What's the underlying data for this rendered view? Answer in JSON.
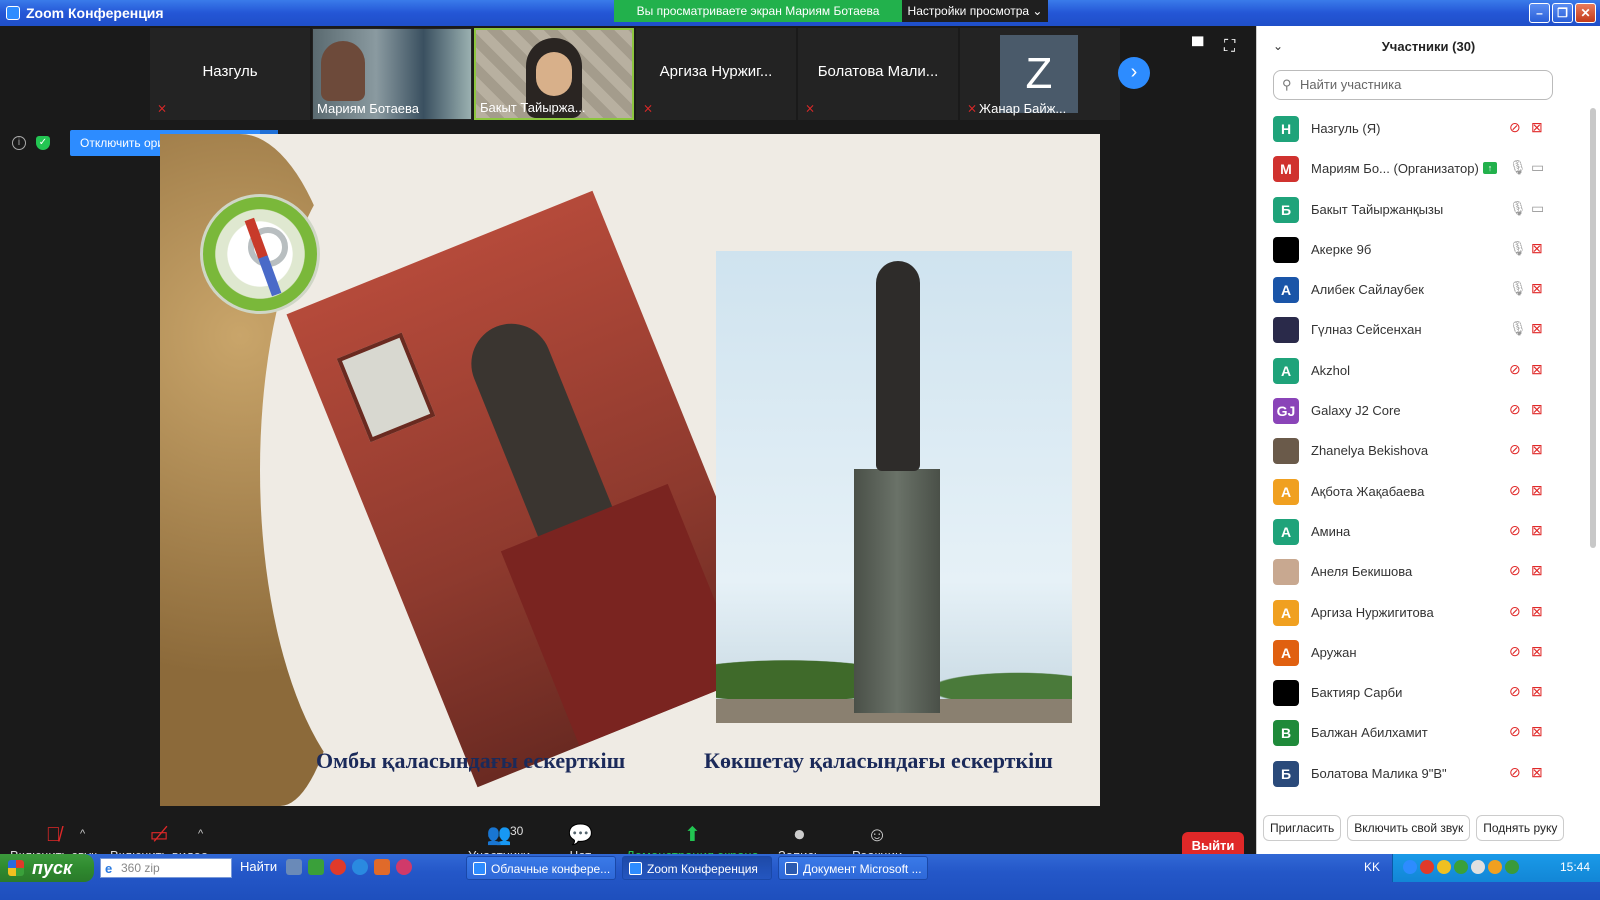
{
  "window": {
    "title": "Zoom Конференция",
    "share_banner": "Вы просматриваете экран Мариям Ботаева",
    "view_options": "Настройки просмотра"
  },
  "video_strip": [
    {
      "name": "Назгуль",
      "type": "name",
      "muted": true
    },
    {
      "name": "Мариям Ботаева",
      "type": "video1",
      "muted": false
    },
    {
      "name": "Бакыт Тайыржа...",
      "type": "video2",
      "muted": false,
      "active": true
    },
    {
      "name": "Аргиза  Нуржиг...",
      "type": "name",
      "muted": true
    },
    {
      "name": "Болатова  Мали...",
      "type": "name",
      "muted": true
    },
    {
      "name": "Жанар Байж...",
      "type": "avatar",
      "initial": "Z",
      "muted": true
    }
  ],
  "audio_control": {
    "original_sound_button": "Отключить оригинальный звук"
  },
  "slide": {
    "caption_left": "Омбы қаласындағы ескерткіш",
    "caption_right": "Көкшетау қаласындағы ескерткіш",
    "caption_color": "#1b2a5a"
  },
  "toolbar": {
    "unmute": "Включить звук",
    "start_video": "Включить видео",
    "participants": "Участники",
    "participants_count": "30",
    "chat": "Чат",
    "share": "Демонстрация экрана",
    "record": "Запись",
    "reactions": "Реакции",
    "leave": "Выйти",
    "leave_color": "#e02828",
    "share_color": "#22c552"
  },
  "panel": {
    "title": "Участники (30)",
    "search_placeholder": "Найти участника",
    "participants": [
      {
        "initial": "Н",
        "name": "Назгуль (Я)",
        "color": "#1fa37a",
        "mic": "off",
        "cam": "off"
      },
      {
        "initial": "М",
        "name": "Мариям Бо...  (Организатор)",
        "color": "#d0322f",
        "mic": "on",
        "cam": "on",
        "sharing": true
      },
      {
        "initial": "Б",
        "name": "Бакыт Тайыржанқызы",
        "color": "#1fa37a",
        "mic": "on",
        "cam": "on"
      },
      {
        "initial": "",
        "name": "Акерке 9б",
        "color": "#000000",
        "mic": "on",
        "cam": "off"
      },
      {
        "initial": "А",
        "name": "Алибек Сайлаубек",
        "color": "#1a55a8",
        "mic": "on",
        "cam": "off"
      },
      {
        "initial": "",
        "name": "Гүлназ Сейсенхан",
        "color": "#2a2a4a",
        "mic": "on",
        "cam": "off"
      },
      {
        "initial": "A",
        "name": "Akzhol",
        "color": "#1fa37a",
        "mic": "off",
        "cam": "off"
      },
      {
        "initial": "GJ",
        "name": "Galaxy J2 Core",
        "color": "#8a44b8",
        "mic": "off",
        "cam": "off"
      },
      {
        "initial": "",
        "name": "Zhanelya Bekishova",
        "color": "#6a5a4a",
        "mic": "off",
        "cam": "off"
      },
      {
        "initial": "А",
        "name": "Ақбота Жақабаева",
        "color": "#f0a020",
        "mic": "off",
        "cam": "off"
      },
      {
        "initial": "А",
        "name": "Амина",
        "color": "#1fa37a",
        "mic": "off",
        "cam": "off"
      },
      {
        "initial": "",
        "name": "Анеля Бекишова",
        "color": "#c8a890",
        "mic": "off",
        "cam": "off"
      },
      {
        "initial": "А",
        "name": "Аргиза Нуржигитова",
        "color": "#f0a020",
        "mic": "off",
        "cam": "off"
      },
      {
        "initial": "А",
        "name": "Аружан",
        "color": "#e06010",
        "mic": "off",
        "cam": "off"
      },
      {
        "initial": "",
        "name": "Бактияр Сарби",
        "color": "#000000",
        "mic": "off",
        "cam": "off"
      },
      {
        "initial": "В",
        "name": "Балжан Абилхамит",
        "color": "#1f8a3a",
        "mic": "off",
        "cam": "off"
      },
      {
        "initial": "Б",
        "name": "Болатова Малика 9\"В\"",
        "color": "#2a4a7a",
        "mic": "off",
        "cam": "off"
      }
    ],
    "invite": "Пригласить",
    "unmute_me": "Включить свой звук",
    "raise_hand": "Поднять руку"
  },
  "taskbar": {
    "start": "пуск",
    "address": "360 zip",
    "find": "Найти",
    "tasks": [
      {
        "label": "Облачные конфере...",
        "icon": "zoom"
      },
      {
        "label": "Zoom Конференция",
        "icon": "zoom",
        "active": true
      },
      {
        "label": "Документ Microsoft ...",
        "icon": "word"
      }
    ],
    "language": "KK",
    "clock": "15:44"
  }
}
